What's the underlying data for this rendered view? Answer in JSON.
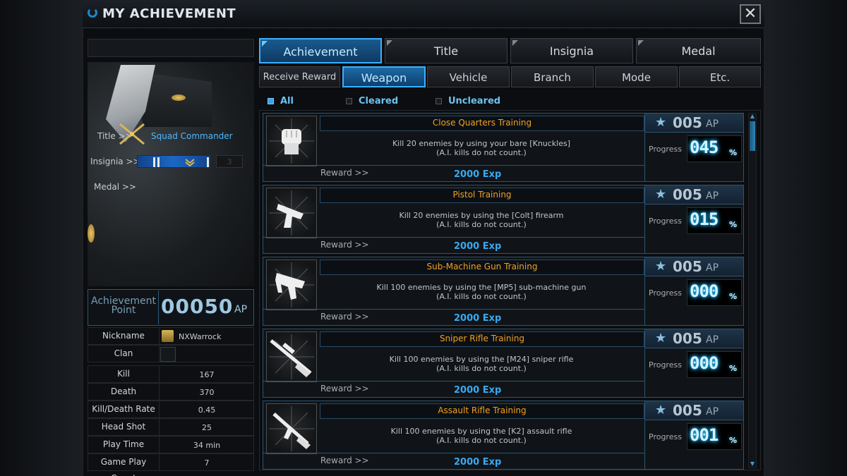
{
  "window": {
    "title": "MY ACHIEVEMENT",
    "close_glyph": "✕"
  },
  "profile": {
    "title_label": "Title >>",
    "title_value": "Squad Commander",
    "insignia_label": "Insignia >>",
    "insignia_count": "3",
    "medal_label": "Medal >>",
    "achievement_point_label_1": "Achievement",
    "achievement_point_label_2": "Point",
    "achievement_point_value": "00050",
    "achievement_point_unit": "AP",
    "stats": [
      {
        "key": "Nickname",
        "value": "NXWarrock"
      },
      {
        "key": "Clan",
        "value": ""
      },
      {
        "key": "Kill",
        "value": "167"
      },
      {
        "key": "Death",
        "value": "370"
      },
      {
        "key": "Kill/Death Rate",
        "value": "0.45"
      },
      {
        "key": "Head Shot",
        "value": "25"
      },
      {
        "key": "Play Time",
        "value": "34 min"
      },
      {
        "key": "Game Play Count",
        "value": "7"
      }
    ]
  },
  "tabs": [
    {
      "label": "Achievement",
      "active": true
    },
    {
      "label": "Title",
      "active": false
    },
    {
      "label": "Insignia",
      "active": false
    },
    {
      "label": "Medal",
      "active": false
    }
  ],
  "subtabs": [
    {
      "label": "Receive Reward",
      "active": false
    },
    {
      "label": "Weapon",
      "active": true
    },
    {
      "label": "Vehicle",
      "active": false
    },
    {
      "label": "Branch",
      "active": false
    },
    {
      "label": "Mode",
      "active": false
    },
    {
      "label": "Etc.",
      "active": false
    }
  ],
  "filters": [
    {
      "label": "All",
      "checked": true
    },
    {
      "label": "Cleared",
      "checked": false
    },
    {
      "label": "Uncleared",
      "checked": false
    }
  ],
  "achievements": [
    {
      "name": "Close Quarters Training",
      "desc1": "Kill 20 enemies by using your bare [Knuckles]",
      "desc2": "(A.I. kills do not count.)",
      "reward_label": "Reward >>",
      "reward": "2000 Exp",
      "ap": "005",
      "ap_unit": "AP",
      "progress_label": "Progress",
      "progress": "045",
      "pct": "%",
      "icon": "fist-icon"
    },
    {
      "name": "Pistol Training",
      "desc1": "Kill 20 enemies by using the [Colt] firearm",
      "desc2": "(A.I. kills do not count.)",
      "reward_label": "Reward >>",
      "reward": "2000 Exp",
      "ap": "005",
      "ap_unit": "AP",
      "progress_label": "Progress",
      "progress": "015",
      "pct": "%",
      "icon": "pistol-icon"
    },
    {
      "name": "Sub-Machine Gun Training",
      "desc1": "Kill 100 enemies by using the [MP5] sub-machine gun",
      "desc2": "(A.I. kills do not count.)",
      "reward_label": "Reward >>",
      "reward": "2000 Exp",
      "ap": "005",
      "ap_unit": "AP",
      "progress_label": "Progress",
      "progress": "000",
      "pct": "%",
      "icon": "smg-icon"
    },
    {
      "name": "Sniper Rifle Training",
      "desc1": "Kill 100 enemies by using the [M24] sniper rifle",
      "desc2": "(A.I. kills do not count.)",
      "reward_label": "Reward >>",
      "reward": "2000 Exp",
      "ap": "005",
      "ap_unit": "AP",
      "progress_label": "Progress",
      "progress": "000",
      "pct": "%",
      "icon": "sniper-rifle-icon"
    },
    {
      "name": "Assault Rifle Training",
      "desc1": "Kill 100 enemies by using the [K2] assault rifle",
      "desc2": "(A.I. kills do not count.)",
      "reward_label": "Reward >>",
      "reward": "2000 Exp",
      "ap": "005",
      "ap_unit": "AP",
      "progress_label": "Progress",
      "progress": "001",
      "pct": "%",
      "icon": "assault-rifle-icon"
    }
  ],
  "colors": {
    "accent": "#3bb0ff",
    "achievement_name": "#f0a020",
    "reward": "#38a9f0"
  }
}
